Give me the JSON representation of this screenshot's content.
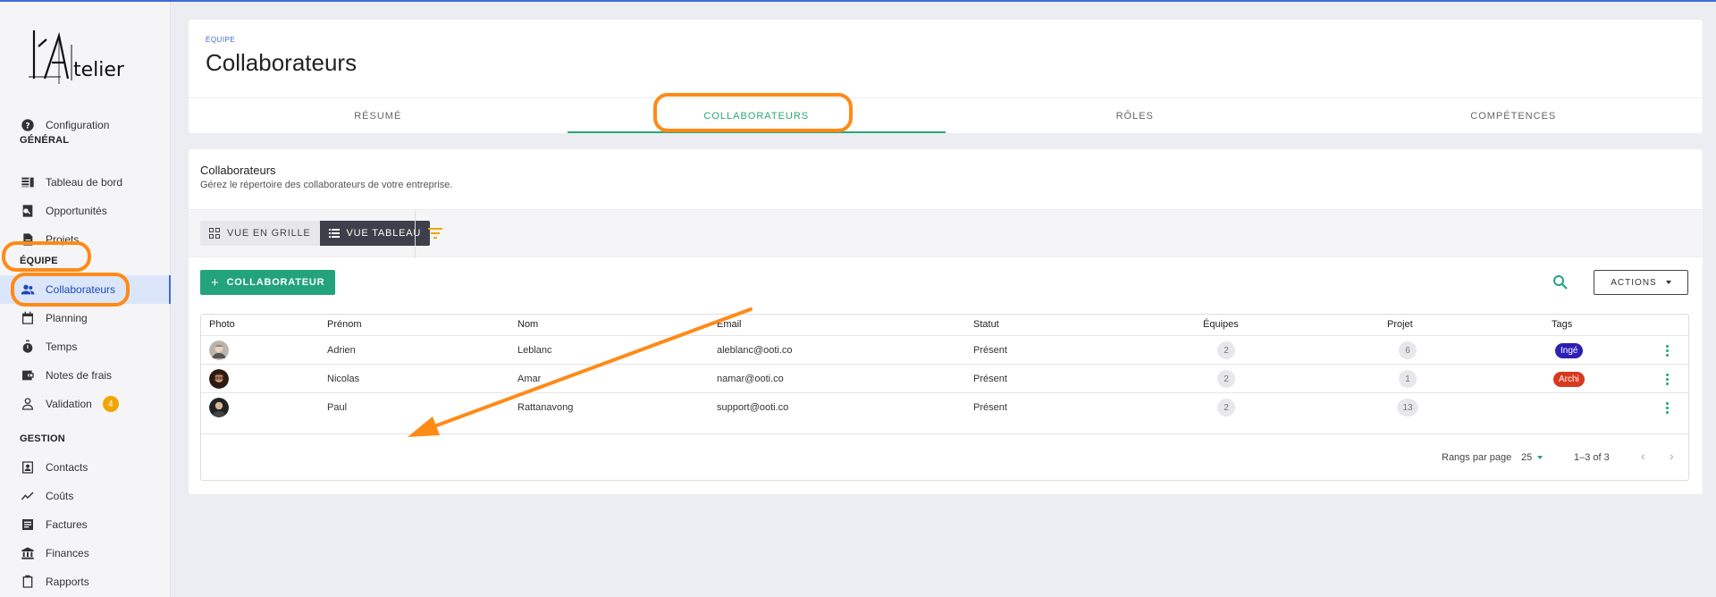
{
  "sidebar": {
    "logo_text": "l'Atelier",
    "items_top": [
      {
        "label": "Configuration",
        "icon": "help-circle-icon"
      }
    ],
    "sections": {
      "general": "GÉNÉRAL",
      "equipe": "ÉQUIPE",
      "gestion": "GESTION"
    },
    "general_items": [
      {
        "label": "Tableau de bord",
        "icon": "dashboard-icon"
      },
      {
        "label": "Opportunités",
        "icon": "search-document-icon"
      },
      {
        "label": "Projets",
        "icon": "document-icon"
      }
    ],
    "equipe_items": [
      {
        "label": "Collaborateurs",
        "icon": "people-icon",
        "active": true
      },
      {
        "label": "Planning",
        "icon": "calendar-icon"
      },
      {
        "label": "Temps",
        "icon": "timer-icon"
      },
      {
        "label": "Notes de frais",
        "icon": "wallet-icon"
      },
      {
        "label": "Validation",
        "icon": "user-check-icon",
        "badge": "4"
      }
    ],
    "gestion_items": [
      {
        "label": "Contacts",
        "icon": "contacts-icon"
      },
      {
        "label": "Coûts",
        "icon": "trend-icon"
      },
      {
        "label": "Factures",
        "icon": "invoice-icon"
      },
      {
        "label": "Finances",
        "icon": "bank-icon"
      },
      {
        "label": "Rapports",
        "icon": "clipboard-icon"
      }
    ]
  },
  "header": {
    "overline": "ÉQUIPE",
    "title": "Collaborateurs",
    "tabs": [
      {
        "label": "RÉSUMÉ"
      },
      {
        "label": "COLLABORATEURS",
        "active": true
      },
      {
        "label": "RÔLES"
      },
      {
        "label": "COMPÉTENCES"
      }
    ]
  },
  "main": {
    "title": "Collaborateurs",
    "subtitle": "Gérez le répertoire des collaborateurs de votre entreprise.",
    "view_grid": "VUE EN GRILLE",
    "view_table": "VUE TABLEAU",
    "add_button": "COLLABORATEUR",
    "actions_button": "ACTIONS",
    "columns": [
      "Photo",
      "Prénom",
      "Nom",
      "Email",
      "Statut",
      "Équipes",
      "Projet",
      "Tags"
    ],
    "rows": [
      {
        "prenom": "Adrien",
        "nom": "Leblanc",
        "email": "aleblanc@ooti.co",
        "statut": "Présent",
        "equipes": "2",
        "projet": "6",
        "tag": "Ingé",
        "tag_color": "#2c1fb5"
      },
      {
        "prenom": "Nicolas",
        "nom": "Amar",
        "email": "namar@ooti.co",
        "statut": "Présent",
        "equipes": "2",
        "projet": "1",
        "tag": "Archi",
        "tag_color": "#d9381e"
      },
      {
        "prenom": "Paul",
        "nom": "Rattanavong",
        "email": "support@ooti.co",
        "statut": "Présent",
        "equipes": "2",
        "projet": "13",
        "tag": "",
        "tag_color": ""
      }
    ],
    "pagination": {
      "rows_per_page_label": "Rangs par page",
      "rows_per_page": "25",
      "range": "1–3 of 3"
    }
  },
  "colors": {
    "accent_green": "#22a37c",
    "accent_blue": "#3f6ad8",
    "highlight": "#ff8a16",
    "badge": "#f0a500"
  }
}
